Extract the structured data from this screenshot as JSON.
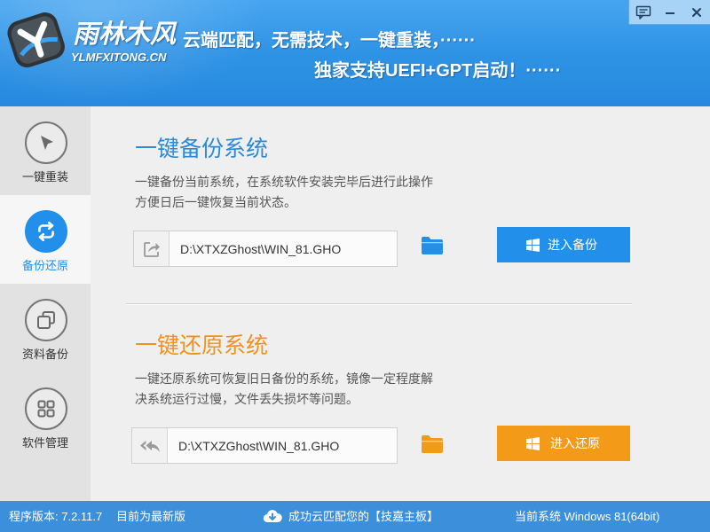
{
  "app": {
    "logo_title": "雨林木风",
    "logo_subtitle": "YLMFXITONG.CN",
    "logo_icon": "logo-emblem"
  },
  "header": {
    "slogan_line1": "云端匹配，无需技术，一键重装，······",
    "slogan_line2": "独家支持UEFI+GPT启动！······"
  },
  "window_controls": {
    "feedback_icon": "feedback-icon",
    "minimize_icon": "minimize-icon",
    "close_icon": "close-icon"
  },
  "sidebar": {
    "items": [
      {
        "label": "一键重装",
        "icon": "cursor-icon",
        "active": false
      },
      {
        "label": "备份还原",
        "icon": "sync-icon",
        "active": true
      },
      {
        "label": "资料备份",
        "icon": "copy-icon",
        "active": false
      },
      {
        "label": "软件管理",
        "icon": "grid-icon",
        "active": false
      }
    ]
  },
  "backup": {
    "title": "一键备份系统",
    "description_line1": "一键备份当前系统，在系统软件安装完毕后进行此操作",
    "description_line2": "方便日后一键恢复当前状态。",
    "path_icon": "export-icon",
    "path": "D:\\XTXZGhost\\WIN_81.GHO",
    "folder_icon": "folder-icon",
    "button_icon": "windows-logo-icon",
    "button_label": "进入备份"
  },
  "restore": {
    "title": "一键还原系统",
    "description_line1": "一键还原系统可恢复旧日备份的系统，镜像一定程度解",
    "description_line2": "决系统运行过慢，文件丢失损坏等问题。",
    "path_icon": "reply-all-icon",
    "path": "D:\\XTXZGhost\\WIN_81.GHO",
    "folder_icon": "folder-icon",
    "button_icon": "windows-logo-icon",
    "button_label": "进入还原"
  },
  "status_bar": {
    "version": "程序版本: 7.2.11.7",
    "update_status": "目前为最新版",
    "cloud_icon": "cloud-download-icon",
    "match_message": "成功云匹配您的【技嘉主板】",
    "current_system": "当前系统 Windows 81(64bit)"
  },
  "colors": {
    "primary": "#2290ea",
    "accent": "#f39a18",
    "backup_title": "#2a8ad8",
    "restore_title": "#f0921d",
    "header": "#2f93e5",
    "status_bar": "#3c8fdb"
  }
}
